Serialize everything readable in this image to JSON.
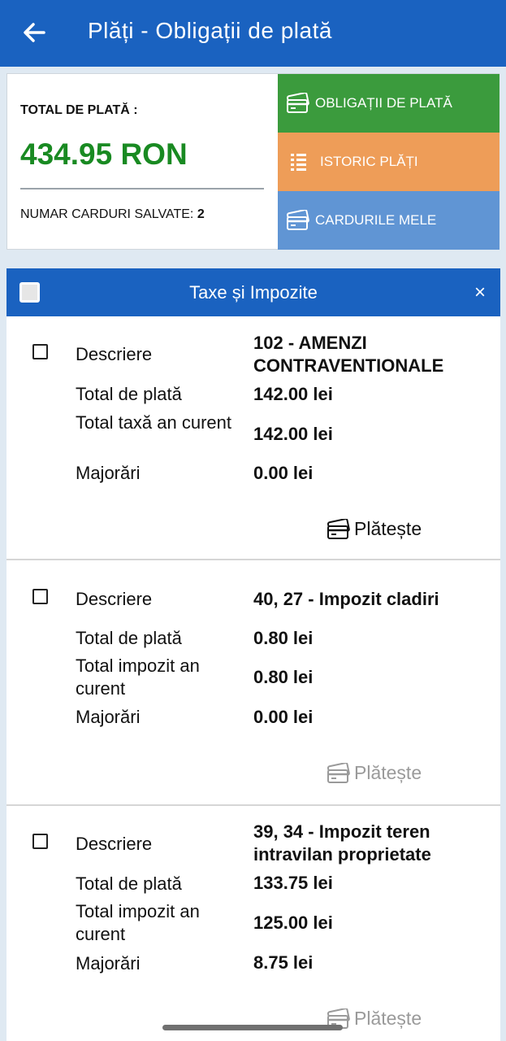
{
  "header": {
    "title": "Plăți - Obligații de plată",
    "back_icon": "arrow-left-icon"
  },
  "summary": {
    "total_label": "TOTAL DE PLATĂ :",
    "total_amount": "434.95 RON",
    "cards_label": "NUMAR CARDURI SALVATE:",
    "cards_count": "2",
    "buttons": [
      {
        "label": "OBLIGAȚII DE PLATĂ",
        "icon": "credit-card-icon",
        "color": "#3b9b3d"
      },
      {
        "label": "ISTORIC PLĂȚI",
        "icon": "list-icon",
        "color": "#ee9d58"
      },
      {
        "label": "CARDURILE MELE",
        "icon": "credit-card-icon",
        "color": "#6095d4"
      }
    ]
  },
  "panel": {
    "title": "Taxe și Impozite",
    "close": "×"
  },
  "items": [
    {
      "desc_label": "Descriere",
      "desc": "102 - AMENZI CONTRAVENTIONALE",
      "total_label": "Total de plată",
      "total": "142.00 lei",
      "current_label": "Total taxă an curent",
      "current": "142.00 lei",
      "extra_label": "Majorări",
      "extra": "0.00 lei",
      "pay_label": "Plătește",
      "pay_enabled": true
    },
    {
      "desc_label": "Descriere",
      "desc": "40, 27 - Impozit cladiri",
      "total_label": "Total de plată",
      "total": "0.80 lei",
      "current_label": "Total impozit an curent",
      "current": "0.80 lei",
      "extra_label": "Majorări",
      "extra": "0.00 lei",
      "pay_label": "Plătește",
      "pay_enabled": false
    },
    {
      "desc_label": "Descriere",
      "desc": "39, 34 - Impozit teren intravilan proprietate",
      "total_label": "Total de plată",
      "total": "133.75 lei",
      "current_label": "Total impozit an curent",
      "current": "125.00 lei",
      "extra_label": "Majorări",
      "extra": "8.75 lei",
      "pay_label": "Plătește",
      "pay_enabled": false
    }
  ],
  "colors": {
    "primary": "#1a62c0",
    "total_green": "#198a22",
    "background": "#dfe9f2"
  }
}
